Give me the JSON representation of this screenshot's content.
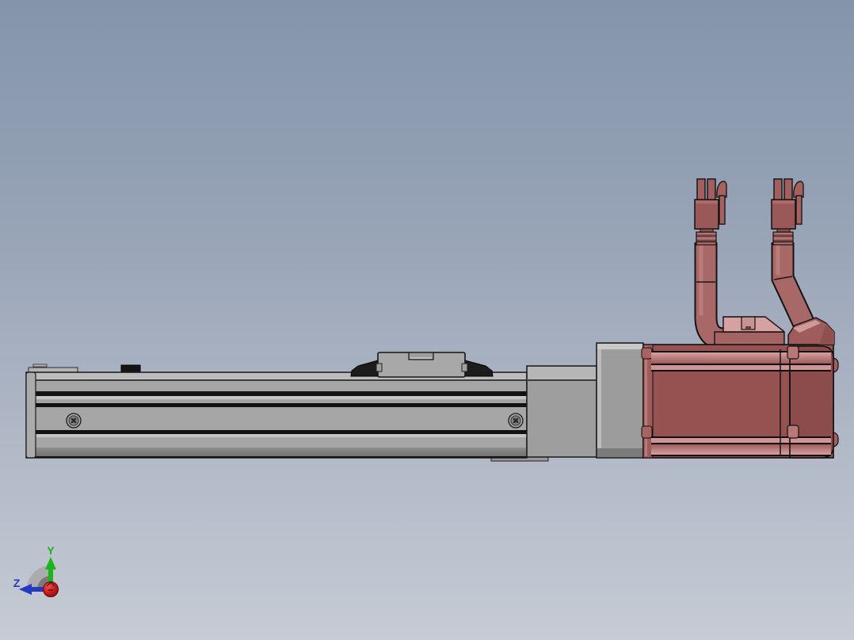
{
  "app": {
    "name": "cad-3d-viewport",
    "view_description": "Side orthographic view of a linear actuator slide module driven by a servo motor with two cable connectors"
  },
  "triad": {
    "y_label": "Y",
    "z_label": "Z",
    "y_color": "#1ab51a",
    "z_color": "#2438c0",
    "x_color": "#c01818"
  },
  "colors": {
    "background_top": "#8495ab",
    "background_bottom": "#c6cbd4",
    "rail_face": "#a6a6a6",
    "rail_flange": "#bdbdbd",
    "rail_groove": "#121212",
    "rail_bottom_band": "#828282",
    "carriage_body": "#a8a8a8",
    "wiper_black": "#1c1c1c",
    "end_plate": "#9e9e9e",
    "coupling_housing": "#9c9c9c",
    "motor_body": "#965151",
    "motor_rear_cap": "#8c4c4c",
    "motor_ridge_light": "#d9a0a0",
    "motor_ridge_mid": "#cf9494",
    "cable": "#a96868",
    "cable_outline": "#141414",
    "connector_body": "#9b5858",
    "connector_prong": "#a35e5e",
    "terminal_box_top": "#d7a1a1",
    "terminal_box_band": "#a56363",
    "cable_gland": "#a05c5c",
    "screw_outer": "#a6a6a6",
    "screw_inner": "#5f5f5f"
  },
  "parts": [
    {
      "id": "linear-rail",
      "label": "Linear actuator rail"
    },
    {
      "id": "slide-carriage",
      "label": "Slide carriage"
    },
    {
      "id": "end-plate",
      "label": "Drive end plate"
    },
    {
      "id": "coupling-housing",
      "label": "Coupling housing"
    },
    {
      "id": "servo-motor",
      "label": "Servo motor"
    },
    {
      "id": "terminal-box",
      "label": "Motor terminal box"
    },
    {
      "id": "cable-gland",
      "label": "Encoder cable gland"
    },
    {
      "id": "power-cable",
      "label": "Power cable with connector"
    },
    {
      "id": "encoder-cable",
      "label": "Encoder cable with connector"
    }
  ]
}
